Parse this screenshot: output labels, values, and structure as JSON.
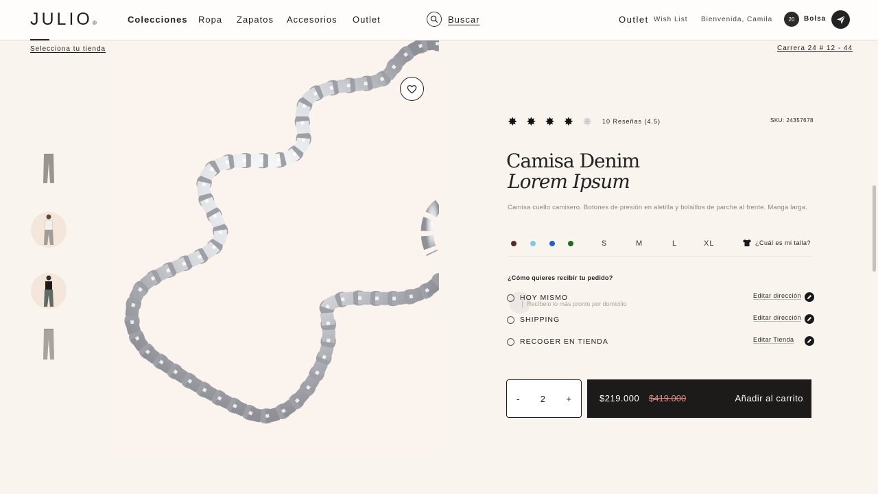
{
  "brand": {
    "logo": "JULIO",
    "logo_mark": "®"
  },
  "nav": {
    "items": [
      "Colecciones",
      "Ropa",
      "Zapatos",
      "Accesorios",
      "Outlet"
    ]
  },
  "search": {
    "label": "Buscar"
  },
  "header_right": {
    "outlet": "Outlet",
    "wish_list": "Wish List",
    "welcome": "Bienvenida, Camila",
    "bag_count": "20",
    "bag_label": "Bolsa"
  },
  "store": {
    "select_label": "Selecciona tu tienda",
    "address": "Carrera 24 # 12 - 44"
  },
  "rating": {
    "value": 4.5,
    "max": 5,
    "reviews_label": "10 Reseñas (4.5)"
  },
  "product": {
    "sku": "SKU: 24357678",
    "title_line1": "Camisa Denim",
    "title_line2": "Lorem Ipsum",
    "description": "Camisa cuello camisero. Botones de presión en aletilla y bolsillos de parche al frente. Manga larga.",
    "colors": [
      "#5a2a2a",
      "#7ec8e8",
      "#1e5fd0",
      "#1f6b1f"
    ],
    "sizes": [
      "S",
      "M",
      "L",
      "XL"
    ],
    "size_help": "¿Cuál es mi talla?"
  },
  "delivery": {
    "question": "¿Cómo quieres recibir tu pedido?",
    "options": [
      {
        "label": "HOY MISMO",
        "sublabel": "Recíbelo lo más pronto por domicilio",
        "edit": "Editar dirección"
      },
      {
        "label": "SHIPPING",
        "edit": "Editar dirección"
      },
      {
        "label": "RECOGER EN TIENDA",
        "edit": "Editar Tienda"
      }
    ]
  },
  "cart": {
    "minus": "-",
    "quantity": "2",
    "plus": "+",
    "price": "$219.000",
    "old_price": "$419.000",
    "add_label": "Añadir al carrito"
  }
}
